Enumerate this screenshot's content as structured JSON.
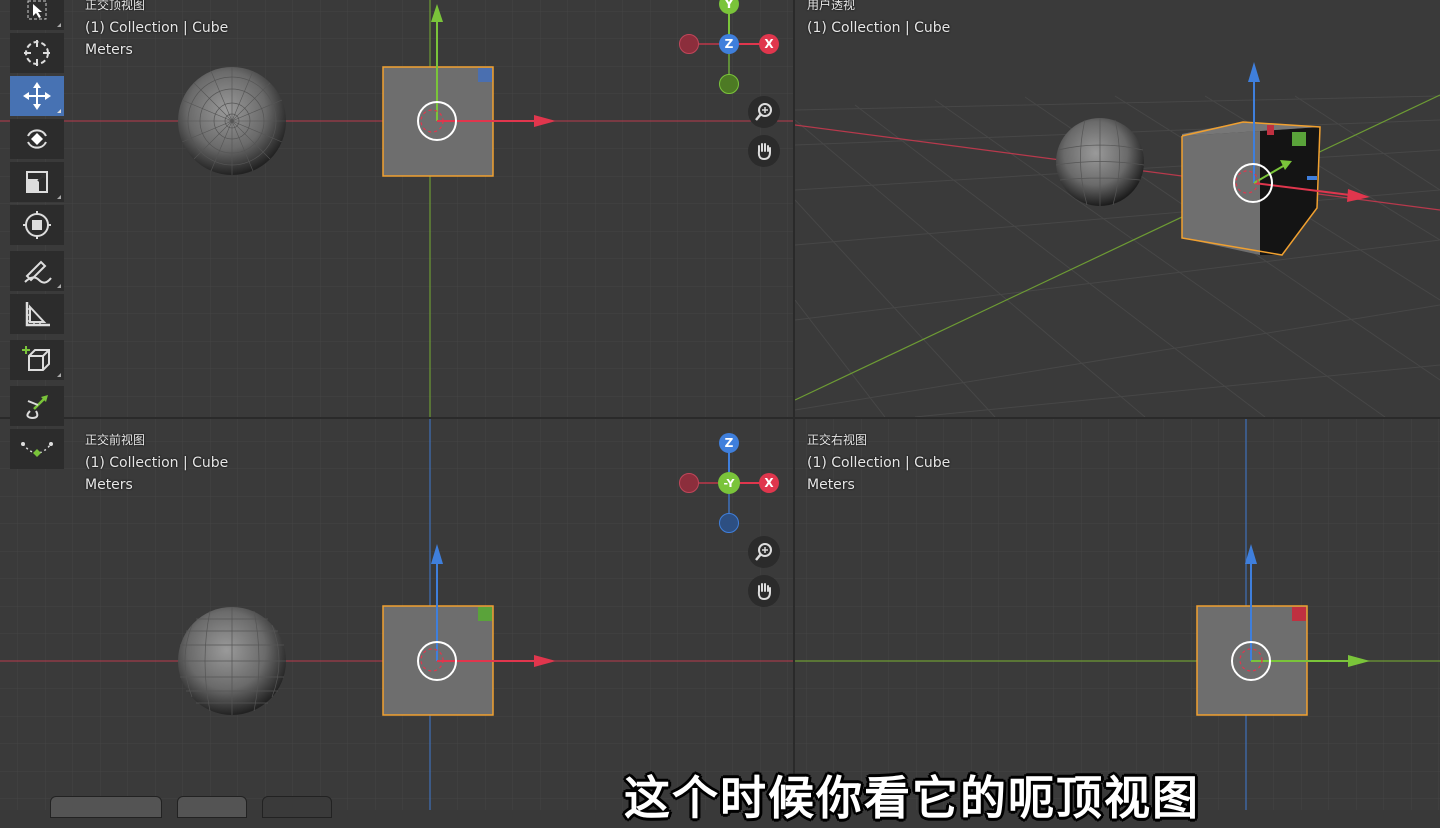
{
  "viewports": {
    "top_left": {
      "view_name": "正交顶视图",
      "collection": "(1) Collection | Cube",
      "units": "Meters"
    },
    "top_right": {
      "view_name": "用户透视",
      "collection": "(1) Collection | Cube",
      "units": ""
    },
    "bottom_left": {
      "view_name": "正交前视图",
      "collection": "(1) Collection | Cube",
      "units": "Meters"
    },
    "bottom_right": {
      "view_name": "正交右视图",
      "collection": "(1) Collection | Cube",
      "units": "Meters"
    }
  },
  "gizmos": {
    "top": {
      "center": "Z",
      "up": "Y",
      "right": "X"
    },
    "front": {
      "center": "-Y",
      "up": "Z",
      "right": "X"
    }
  },
  "toolbar": {
    "tools": [
      "select-box",
      "cursor",
      "move",
      "rotate",
      "scale",
      "transform",
      "annotate",
      "measure",
      "add-cube",
      "extrude",
      "curve"
    ],
    "active": "move"
  },
  "subtitle": "这个时候你看它的呃顶视图",
  "colors": {
    "x_axis": "#e0364d",
    "y_axis": "#7ac43a",
    "z_axis": "#3f7fdc",
    "selection": "#f0a030",
    "active_tool": "#4772b3"
  }
}
